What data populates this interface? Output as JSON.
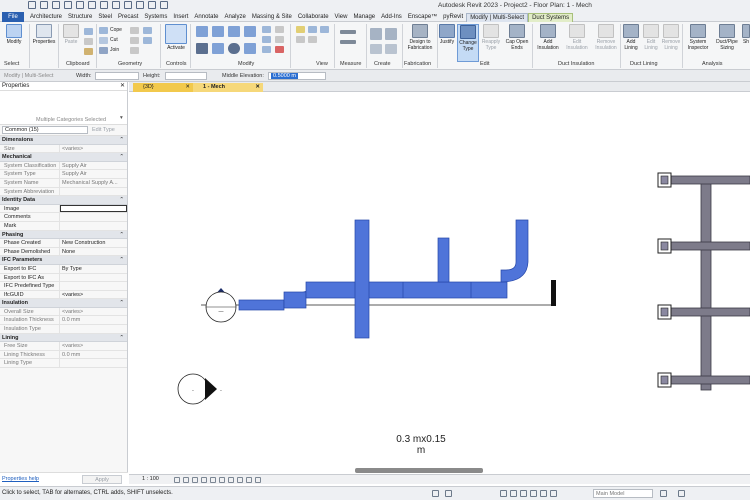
{
  "app_title": "Autodesk Revit 2023 - Project2 - Floor Plan: 1 - Mech",
  "file_tab": "File",
  "tabs": [
    "Architecture",
    "Structure",
    "Steel",
    "Precast",
    "Systems",
    "Insert",
    "Annotate",
    "Analyze",
    "Massing & Site",
    "Collaborate",
    "View",
    "Manage",
    "Add-Ins",
    "Enscape™",
    "pyRevit"
  ],
  "context_tabs": {
    "modify": "Modify | Multi-Select",
    "duct": "Duct Systems"
  },
  "ribbon": {
    "modify": "Modify",
    "select": "Select",
    "properties": "Properties",
    "paste": "Paste",
    "clipboard": "Clipboard",
    "cope": "Cope",
    "cut": "Cut",
    "join": "Join",
    "geometry": "Geometry",
    "activate": "Activate",
    "controls": "Controls",
    "modify_panel": "Modify",
    "view_panel": "View",
    "measure": "Measure",
    "create": "Create",
    "design_to_fabrication": "Design to Fabrication",
    "fabrication": "Fabrication",
    "justify": "Justify",
    "change_type": "Change Type",
    "reapply_type": "Reapply Type",
    "cap_open_ends": "Cap Open Ends",
    "edit": "Edit",
    "add_insulation": "Add Insulation",
    "edit_insulation": "Edit Insulation",
    "remove_insulation": "Remove Insulation",
    "duct_insulation": "Duct Insulation",
    "add_lining": "Add Lining",
    "edit_lining": "Edit Lining",
    "remove_lining": "Remove Lining",
    "duct_lining": "Duct Lining",
    "system_inspector": "System Inspector",
    "duct_pipe_sizing": "Duct/Pipe Sizing",
    "show": "Sh",
    "analysis": "Analysis"
  },
  "options_bar": {
    "context": "Modify | Multi-Select",
    "width_label": "Width:",
    "height_label": "Height:",
    "middle_elevation_label": "Middle Elevation:",
    "middle_elevation_value": "0.5000 m"
  },
  "properties": {
    "header": "Properties",
    "type_selector": "Multiple Categories Selected",
    "filter": "Common (15)",
    "edit_type": "Edit Type",
    "groups": [
      {
        "name": "Dimensions",
        "rows": [
          {
            "k": "Size",
            "v": "<varies>",
            "ro": true
          }
        ]
      },
      {
        "name": "Mechanical",
        "rows": [
          {
            "k": "System Classification",
            "v": "Supply Air",
            "ro": true
          },
          {
            "k": "System Type",
            "v": "Supply Air",
            "ro": true
          },
          {
            "k": "System Name",
            "v": "Mechanical Supply A...",
            "ro": true
          },
          {
            "k": "System Abbreviation",
            "v": "",
            "ro": true
          }
        ]
      },
      {
        "name": "Identity Data",
        "rows": [
          {
            "k": "Image",
            "v": "",
            "ro": false,
            "box": true
          },
          {
            "k": "Comments",
            "v": "",
            "ro": false
          },
          {
            "k": "Mark",
            "v": "",
            "ro": false
          }
        ]
      },
      {
        "name": "Phasing",
        "rows": [
          {
            "k": "Phase Created",
            "v": "New Construction",
            "ro": false
          },
          {
            "k": "Phase Demolished",
            "v": "None",
            "ro": false
          }
        ]
      },
      {
        "name": "IFC Parameters",
        "rows": [
          {
            "k": "Export to IFC",
            "v": "By Type",
            "ro": false
          },
          {
            "k": "Export to IFC As",
            "v": "",
            "ro": false
          },
          {
            "k": "IFC Predefined Type",
            "v": "",
            "ro": false
          },
          {
            "k": "IfcGUID",
            "v": "<varies>",
            "ro": false
          }
        ]
      },
      {
        "name": "Insulation",
        "rows": [
          {
            "k": "Overall Size",
            "v": "<varies>",
            "ro": true
          },
          {
            "k": "Insulation Thickness",
            "v": "0.0 mm",
            "ro": true
          },
          {
            "k": "Insulation Type",
            "v": "",
            "ro": true
          }
        ]
      },
      {
        "name": "Lining",
        "rows": [
          {
            "k": "Free Size",
            "v": "<varies>",
            "ro": true
          },
          {
            "k": "Lining Thickness",
            "v": "0.0 mm",
            "ro": true
          },
          {
            "k": "Lining Type",
            "v": "",
            "ro": true
          }
        ]
      }
    ],
    "help_link": "Properties help",
    "apply": "Apply"
  },
  "view_tabs": [
    {
      "label": "{3D}",
      "active": false
    },
    {
      "label": "1 - Mech",
      "active": true
    }
  ],
  "canvas": {
    "duct_size_label_line1": "0.3 mx0.15",
    "duct_size_label_line2": "m",
    "duct_color": "#4f74d9",
    "duct_edge": "#2647a8",
    "grey_duct_color": "#7d7b8a"
  },
  "view_bar": {
    "scale": "1 : 100"
  },
  "status": {
    "text": "Click to select, TAB for alternates, CTRL adds, SHIFT unselects.",
    "workset": "Main Model"
  },
  "colors": {
    "file_tab": "#2a5fb0",
    "accent": "#2c6fd1",
    "view_tab_active": "#f2c94c"
  }
}
